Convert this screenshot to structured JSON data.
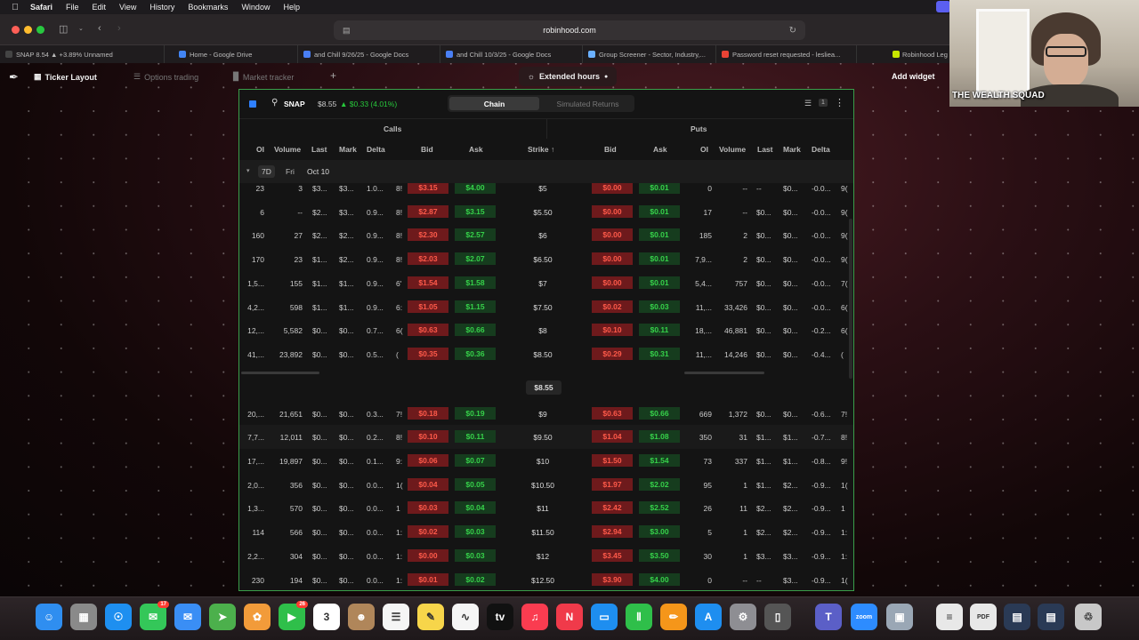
{
  "menubar": {
    "items": [
      "Safari",
      "File",
      "Edit",
      "View",
      "History",
      "Bookmarks",
      "Window",
      "Help"
    ]
  },
  "browser": {
    "url": "robinhood.com",
    "tabs": [
      {
        "label": "SNAP 8.54 ▲ +3.89% Unnamed",
        "color": "#444444"
      },
      {
        "label": "Home - Google Drive",
        "color": "#4285f4"
      },
      {
        "label": "and Chill 9/26/25 - Google Docs",
        "color": "#4a7ff5"
      },
      {
        "label": "and Chill 10/3/25 - Google Docs",
        "color": "#4a7ff5"
      },
      {
        "label": "Group Screener - Sector, Industry,...",
        "color": "#6ab0ff"
      },
      {
        "label": "Password reset requested - lesliea...",
        "color": "#ea4335"
      }
    ],
    "extra_tab": "Robinhood Leg"
  },
  "app": {
    "nav": [
      {
        "label": "Ticker Layout",
        "icon": "layout-icon",
        "active": true
      },
      {
        "label": "Options trading",
        "icon": "list-icon",
        "active": false
      },
      {
        "label": "Market tracker",
        "icon": "bar-chart-icon",
        "active": false
      }
    ],
    "add_tab": "+",
    "extended_hours": "Extended hours",
    "add_widget": "Add widget"
  },
  "widget": {
    "symbol": "SNAP",
    "price": "$8.55",
    "change": "▲ $0.33 (4.01%)",
    "view_tabs": [
      "Chain",
      "Simulated Returns"
    ],
    "filter_count": "1",
    "calls_label": "Calls",
    "puts_label": "Puts",
    "call_columns": [
      "OI",
      "Volume",
      "Last",
      "Mark",
      "Delta",
      "Bid",
      "Ask"
    ],
    "strike_label": "Strike ↑",
    "put_columns": [
      "Bid",
      "Ask",
      "OI",
      "Volume",
      "Last",
      "Mark",
      "Delta"
    ],
    "expiration": {
      "tag": "7D",
      "day": "Fri",
      "date": "Oct 10"
    },
    "current_price": "$8.55"
  },
  "chain_rows_above": [
    {
      "c_oi": "23",
      "c_vol": "3",
      "c_last": "$3...",
      "c_mark": "$3...",
      "c_delta": "1.0...",
      "c_x": "8!",
      "c_bid": "$3.15",
      "c_ask": "$4.00",
      "strike": "$5",
      "p_bid": "$0.00",
      "p_ask": "$0.01",
      "p_oi": "0",
      "p_vol": "--",
      "p_last": "--",
      "p_mark": "$0...",
      "p_delta": "-0.0...",
      "p_x": "9("
    },
    {
      "c_oi": "6",
      "c_vol": "--",
      "c_last": "$2...",
      "c_mark": "$3...",
      "c_delta": "0.9...",
      "c_x": "8!",
      "c_bid": "$2.87",
      "c_ask": "$3.15",
      "strike": "$5.50",
      "p_bid": "$0.00",
      "p_ask": "$0.01",
      "p_oi": "17",
      "p_vol": "--",
      "p_last": "$0...",
      "p_mark": "$0...",
      "p_delta": "-0.0...",
      "p_x": "9("
    },
    {
      "c_oi": "160",
      "c_vol": "27",
      "c_last": "$2...",
      "c_mark": "$2...",
      "c_delta": "0.9...",
      "c_x": "8!",
      "c_bid": "$2.30",
      "c_ask": "$2.57",
      "strike": "$6",
      "p_bid": "$0.00",
      "p_ask": "$0.01",
      "p_oi": "185",
      "p_vol": "2",
      "p_last": "$0...",
      "p_mark": "$0...",
      "p_delta": "-0.0...",
      "p_x": "9("
    },
    {
      "c_oi": "170",
      "c_vol": "23",
      "c_last": "$1...",
      "c_mark": "$2...",
      "c_delta": "0.9...",
      "c_x": "8!",
      "c_bid": "$2.03",
      "c_ask": "$2.07",
      "strike": "$6.50",
      "p_bid": "$0.00",
      "p_ask": "$0.01",
      "p_oi": "7,9...",
      "p_vol": "2",
      "p_last": "$0...",
      "p_mark": "$0...",
      "p_delta": "-0.0...",
      "p_x": "9("
    },
    {
      "c_oi": "1,5...",
      "c_vol": "155",
      "c_last": "$1...",
      "c_mark": "$1...",
      "c_delta": "0.9...",
      "c_x": "6'",
      "c_bid": "$1.54",
      "c_ask": "$1.58",
      "strike": "$7",
      "p_bid": "$0.00",
      "p_ask": "$0.01",
      "p_oi": "5,4...",
      "p_vol": "757",
      "p_last": "$0...",
      "p_mark": "$0...",
      "p_delta": "-0.0...",
      "p_x": "7("
    },
    {
      "c_oi": "4,2...",
      "c_vol": "598",
      "c_last": "$1...",
      "c_mark": "$1...",
      "c_delta": "0.9...",
      "c_x": "6:",
      "c_bid": "$1.05",
      "c_ask": "$1.15",
      "strike": "$7.50",
      "p_bid": "$0.02",
      "p_ask": "$0.03",
      "p_oi": "11,...",
      "p_vol": "33,426",
      "p_last": "$0...",
      "p_mark": "$0...",
      "p_delta": "-0.0...",
      "p_x": "6("
    },
    {
      "c_oi": "12,...",
      "c_vol": "5,582",
      "c_last": "$0...",
      "c_mark": "$0...",
      "c_delta": "0.7...",
      "c_x": "6(",
      "c_bid": "$0.63",
      "c_ask": "$0.66",
      "strike": "$8",
      "p_bid": "$0.10",
      "p_ask": "$0.11",
      "p_oi": "18,...",
      "p_vol": "46,881",
      "p_last": "$0...",
      "p_mark": "$0...",
      "p_delta": "-0.2...",
      "p_x": "6("
    },
    {
      "c_oi": "41,...",
      "c_vol": "23,892",
      "c_last": "$0...",
      "c_mark": "$0...",
      "c_delta": "0.5...",
      "c_x": "(",
      "c_bid": "$0.35",
      "c_ask": "$0.36",
      "strike": "$8.50",
      "p_bid": "$0.29",
      "p_ask": "$0.31",
      "p_oi": "11,...",
      "p_vol": "14,246",
      "p_last": "$0...",
      "p_mark": "$0...",
      "p_delta": "-0.4...",
      "p_x": "("
    }
  ],
  "chain_rows_below": [
    {
      "c_oi": "20,...",
      "c_vol": "21,651",
      "c_last": "$0...",
      "c_mark": "$0...",
      "c_delta": "0.3...",
      "c_x": "7!",
      "c_bid": "$0.18",
      "c_ask": "$0.19",
      "strike": "$9",
      "p_bid": "$0.63",
      "p_ask": "$0.66",
      "p_oi": "669",
      "p_vol": "1,372",
      "p_last": "$0...",
      "p_mark": "$0...",
      "p_delta": "-0.6...",
      "p_x": "7!"
    },
    {
      "c_oi": "7,7...",
      "c_vol": "12,011",
      "c_last": "$0...",
      "c_mark": "$0...",
      "c_delta": "0.2...",
      "c_x": "8!",
      "c_bid": "$0.10",
      "c_ask": "$0.11",
      "strike": "$9.50",
      "p_bid": "$1.04",
      "p_ask": "$1.08",
      "p_oi": "350",
      "p_vol": "31",
      "p_last": "$1...",
      "p_mark": "$1...",
      "p_delta": "-0.7...",
      "p_x": "8!"
    },
    {
      "c_oi": "17,...",
      "c_vol": "19,897",
      "c_last": "$0...",
      "c_mark": "$0...",
      "c_delta": "0.1...",
      "c_x": "9:",
      "c_bid": "$0.06",
      "c_ask": "$0.07",
      "strike": "$10",
      "p_bid": "$1.50",
      "p_ask": "$1.54",
      "p_oi": "73",
      "p_vol": "337",
      "p_last": "$1...",
      "p_mark": "$1...",
      "p_delta": "-0.8...",
      "p_x": "9!"
    },
    {
      "c_oi": "2,0...",
      "c_vol": "356",
      "c_last": "$0...",
      "c_mark": "$0...",
      "c_delta": "0.0...",
      "c_x": "1(",
      "c_bid": "$0.04",
      "c_ask": "$0.05",
      "strike": "$10.50",
      "p_bid": "$1.97",
      "p_ask": "$2.02",
      "p_oi": "95",
      "p_vol": "1",
      "p_last": "$1...",
      "p_mark": "$2...",
      "p_delta": "-0.9...",
      "p_x": "1("
    },
    {
      "c_oi": "1,3...",
      "c_vol": "570",
      "c_last": "$0...",
      "c_mark": "$0...",
      "c_delta": "0.0...",
      "c_x": "1",
      "c_bid": "$0.03",
      "c_ask": "$0.04",
      "strike": "$11",
      "p_bid": "$2.42",
      "p_ask": "$2.52",
      "p_oi": "26",
      "p_vol": "11",
      "p_last": "$2...",
      "p_mark": "$2...",
      "p_delta": "-0.9...",
      "p_x": "1"
    },
    {
      "c_oi": "114",
      "c_vol": "566",
      "c_last": "$0...",
      "c_mark": "$0...",
      "c_delta": "0.0...",
      "c_x": "1:",
      "c_bid": "$0.02",
      "c_ask": "$0.03",
      "strike": "$11.50",
      "p_bid": "$2.94",
      "p_ask": "$3.00",
      "p_oi": "5",
      "p_vol": "1",
      "p_last": "$2...",
      "p_mark": "$2...",
      "p_delta": "-0.9...",
      "p_x": "1:"
    },
    {
      "c_oi": "2,2...",
      "c_vol": "304",
      "c_last": "$0...",
      "c_mark": "$0...",
      "c_delta": "0.0...",
      "c_x": "1:",
      "c_bid": "$0.00",
      "c_ask": "$0.03",
      "strike": "$12",
      "p_bid": "$3.45",
      "p_ask": "$3.50",
      "p_oi": "30",
      "p_vol": "1",
      "p_last": "$3...",
      "p_mark": "$3...",
      "p_delta": "-0.9...",
      "p_x": "1:"
    },
    {
      "c_oi": "230",
      "c_vol": "194",
      "c_last": "$0...",
      "c_mark": "$0...",
      "c_delta": "0.0...",
      "c_x": "1:",
      "c_bid": "$0.01",
      "c_ask": "$0.02",
      "strike": "$12.50",
      "p_bid": "$3.90",
      "p_ask": "$4.00",
      "p_oi": "0",
      "p_vol": "--",
      "p_last": "--",
      "p_mark": "$3...",
      "p_delta": "-0.9...",
      "p_x": "1("
    }
  ],
  "webcam": {
    "caption": "THE WEALTH SQUAD"
  },
  "dock": {
    "apps": [
      {
        "name": "finder-icon",
        "color": "#2f8ef0",
        "glyph": "☺"
      },
      {
        "name": "launchpad-icon",
        "color": "#8a8a8a",
        "glyph": "▦"
      },
      {
        "name": "safari-icon",
        "color": "#1e8ff0",
        "glyph": "☉"
      },
      {
        "name": "messages-icon",
        "color": "#34c759",
        "glyph": "✉",
        "badge": "17"
      },
      {
        "name": "mail-icon",
        "color": "#3a8ef5",
        "glyph": "✉"
      },
      {
        "name": "maps-icon",
        "color": "#4cb04c",
        "glyph": "➤"
      },
      {
        "name": "photos-icon",
        "color": "#f29b3a",
        "glyph": "✿"
      },
      {
        "name": "facetime-icon",
        "color": "#2fbf4a",
        "glyph": "▶",
        "badge": "26"
      },
      {
        "name": "calendar-icon",
        "color": "#ffffff",
        "glyph": "3"
      },
      {
        "name": "contacts-icon",
        "color": "#b0865a",
        "glyph": "☻"
      },
      {
        "name": "reminders-icon",
        "color": "#f5f5f5",
        "glyph": "☰"
      },
      {
        "name": "notes-icon",
        "color": "#f7d54a",
        "glyph": "✎"
      },
      {
        "name": "freeform-icon",
        "color": "#f5f5f5",
        "glyph": "∿"
      },
      {
        "name": "tv-icon",
        "color": "#111111",
        "glyph": "tv"
      },
      {
        "name": "music-icon",
        "color": "#fa3c50",
        "glyph": "♫"
      },
      {
        "name": "news-icon",
        "color": "#f03a4a",
        "glyph": "N"
      },
      {
        "name": "keynote-icon",
        "color": "#1e8ef0",
        "glyph": "▭"
      },
      {
        "name": "numbers-icon",
        "color": "#2fbf4a",
        "glyph": "Ⅱ"
      },
      {
        "name": "pages-icon",
        "color": "#f5961a",
        "glyph": "✏"
      },
      {
        "name": "appstore-icon",
        "color": "#1e8ef0",
        "glyph": "A"
      },
      {
        "name": "settings-icon",
        "color": "#8e8e93",
        "glyph": "⚙"
      },
      {
        "name": "iphone-mirroring-icon",
        "color": "#555555",
        "glyph": "▯"
      },
      {
        "name": "teams-icon",
        "color": "#5b5fc7",
        "glyph": "T"
      },
      {
        "name": "zoom-icon",
        "color": "#2d8cff",
        "glyph": "zoom"
      },
      {
        "name": "preview-icon",
        "color": "#9aa7b5",
        "glyph": "▣"
      },
      {
        "name": "document-icon",
        "color": "#e8e8e8",
        "glyph": "≡"
      },
      {
        "name": "pdf-icon",
        "color": "#e8e8e8",
        "glyph": "PDF"
      },
      {
        "name": "screenshot-icon",
        "color": "#2a3a55",
        "glyph": "▤"
      },
      {
        "name": "screen-icon",
        "color": "#2a3a55",
        "glyph": "▤"
      },
      {
        "name": "trash-icon",
        "color": "#c8c8c8",
        "glyph": "♲"
      }
    ]
  }
}
